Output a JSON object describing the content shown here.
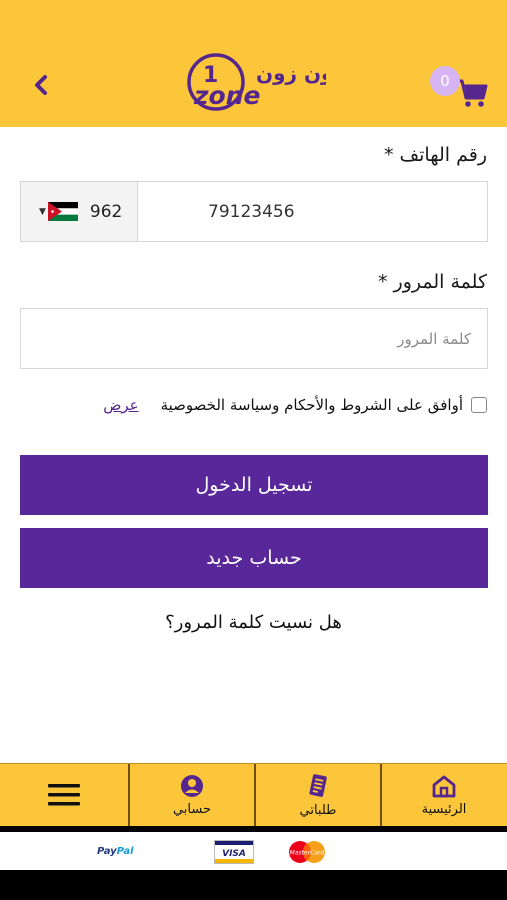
{
  "header": {
    "back_icon": "chevron-left-icon",
    "logo_arabic": "ون زون",
    "logo_number": "1",
    "logo_word": "zone",
    "cart_icon": "cart-icon",
    "cart_count": "0"
  },
  "form": {
    "phone_label": "رقم الهاتف *",
    "country_code": "962",
    "country_flag": "jordan-flag-icon",
    "phone_value": "79123456",
    "password_label": "كلمة المرور *",
    "password_placeholder": "كلمة المرور",
    "terms_text": "أوافق على الشروط والأحكام وسياسة الخصوصية",
    "terms_link": "عرض",
    "login_button": "تسجيل الدخول",
    "register_button": "حساب جديد",
    "forgot_password": "هل نسيت كلمة المرور؟"
  },
  "bottom_nav": {
    "menu_icon": "hamburger-menu-icon",
    "items": [
      {
        "label": "حسابي",
        "icon": "account-icon"
      },
      {
        "label": "طلباتي",
        "icon": "orders-icon"
      },
      {
        "label": "الرئيسية",
        "icon": "home-icon"
      }
    ]
  },
  "payments": {
    "paypal_pay": "Pay",
    "paypal_pal": "Pal",
    "visa": "VISA",
    "mastercard": "MasterCard"
  },
  "colors": {
    "brand_yellow": "#fcc63b",
    "brand_purple": "#58279a",
    "badge_lilac": "#d7b4f3"
  }
}
